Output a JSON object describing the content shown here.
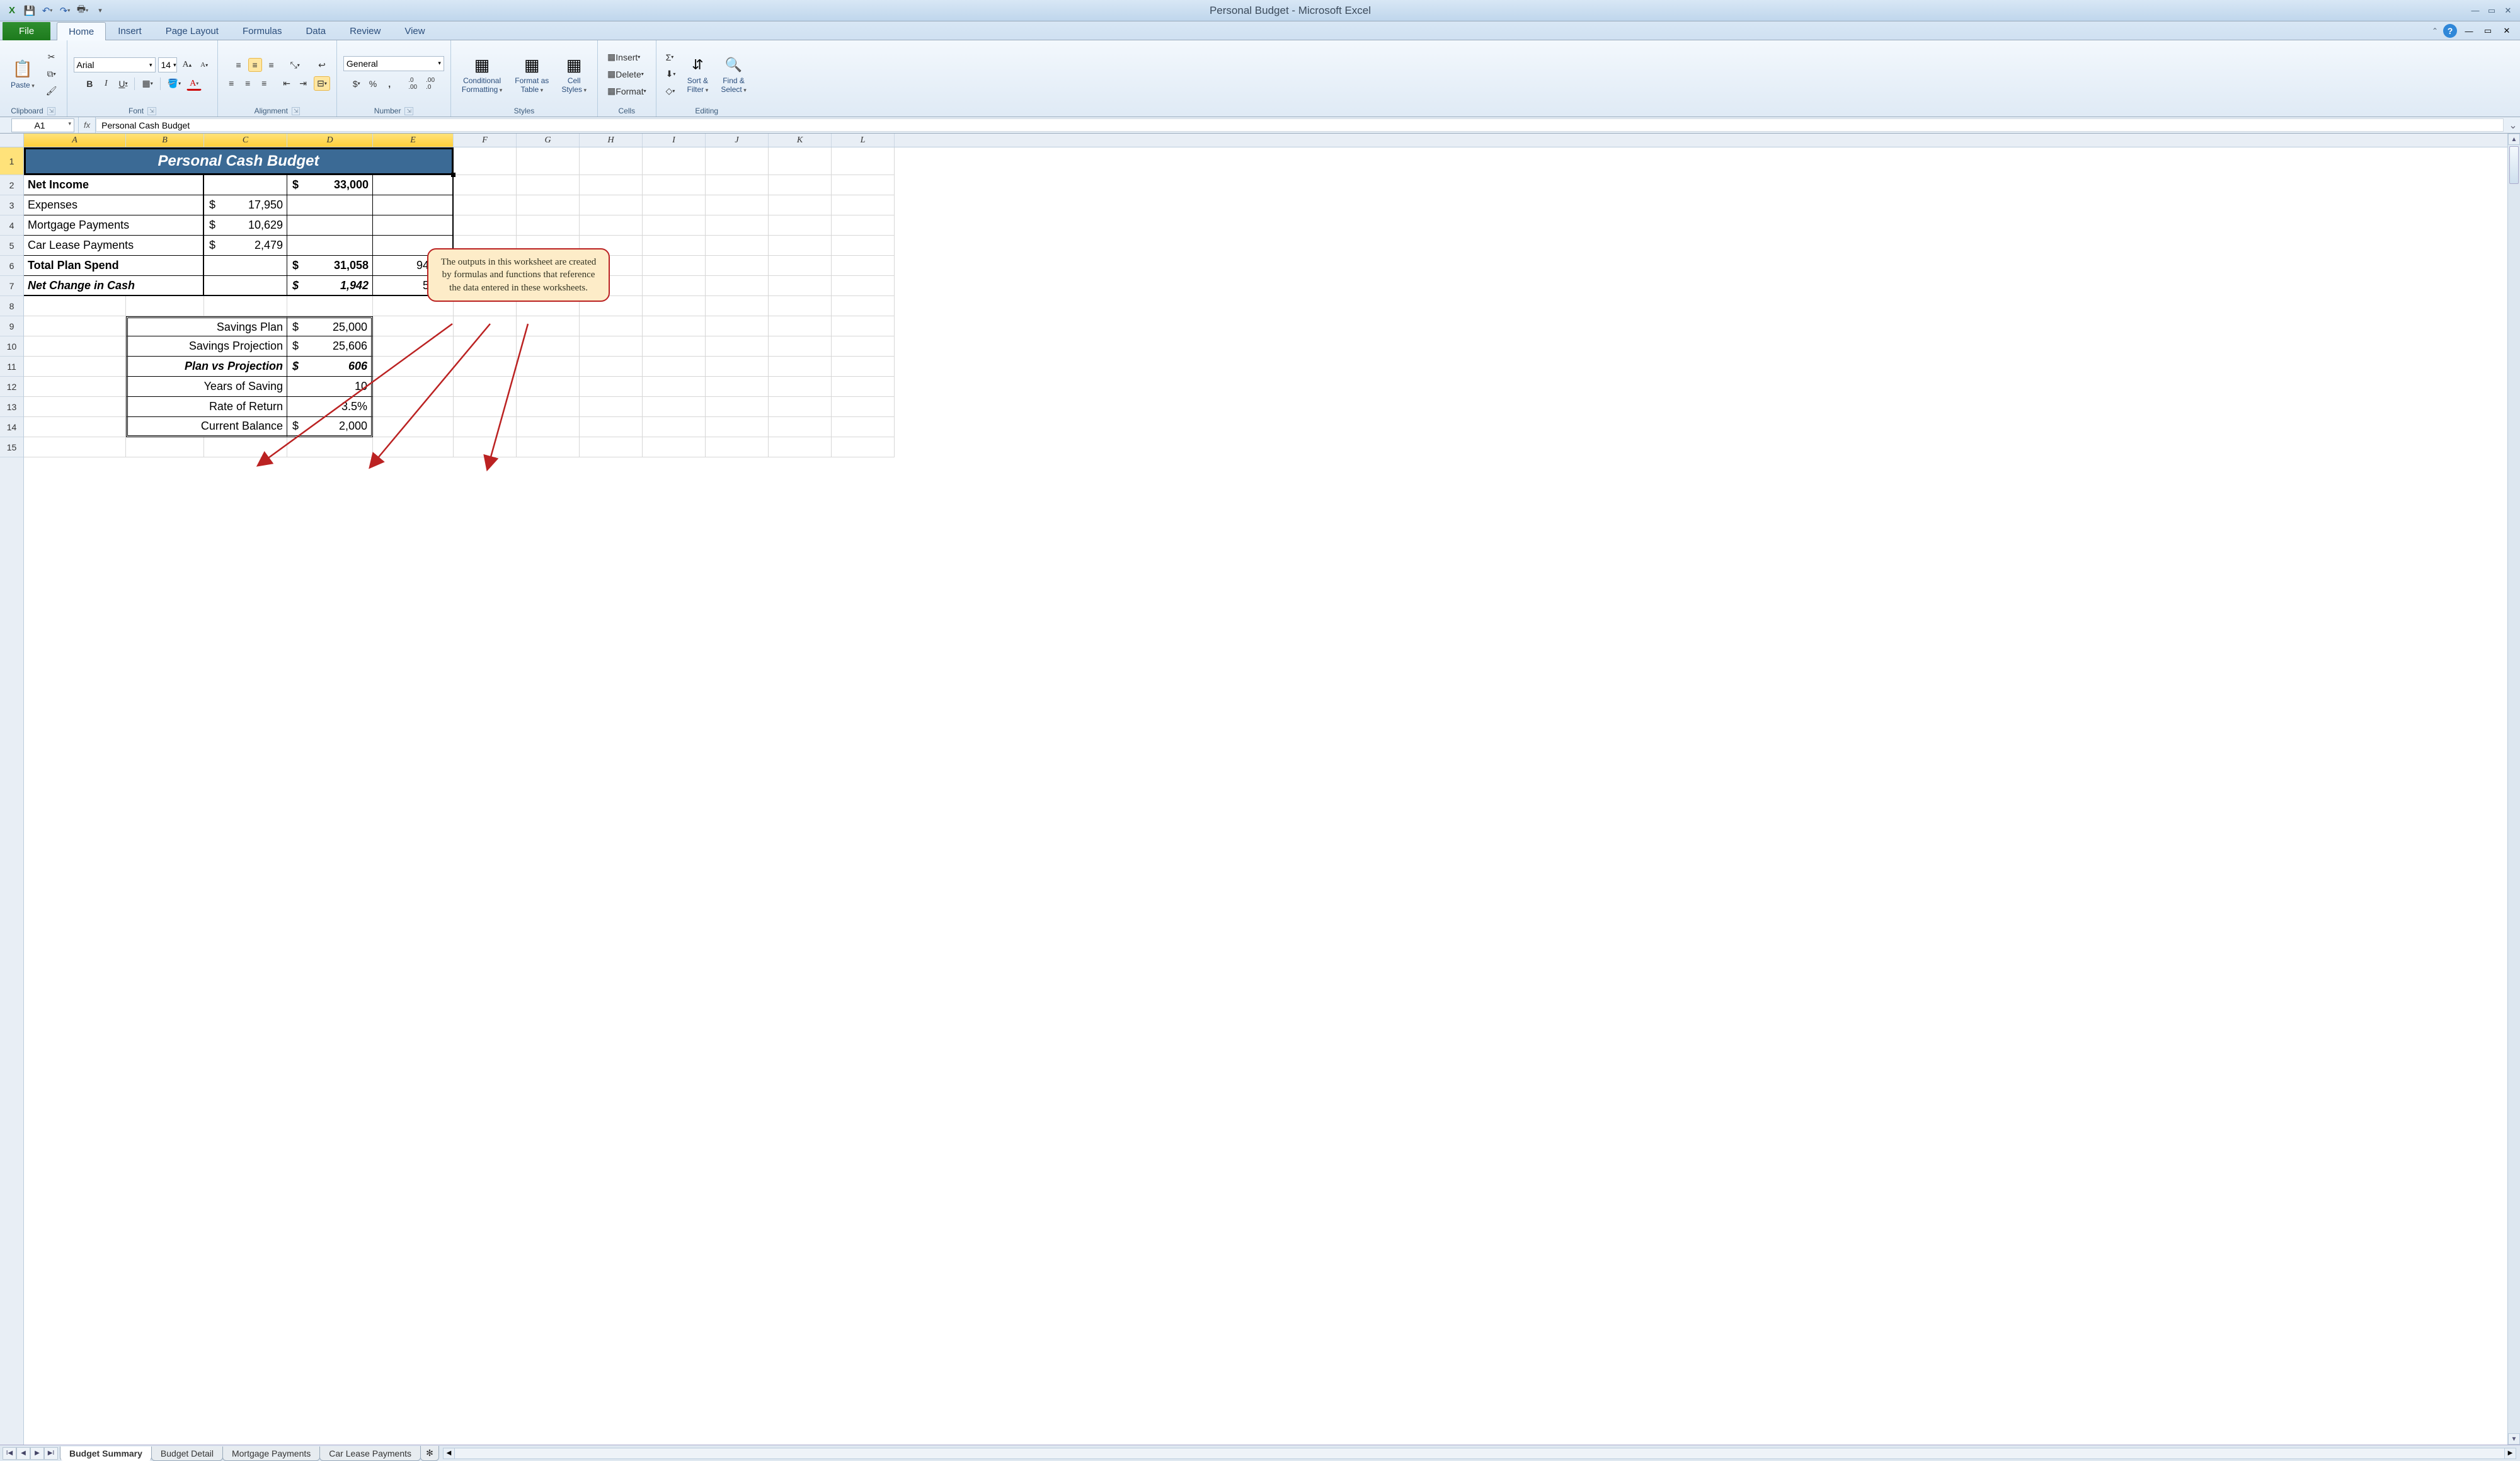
{
  "window": {
    "title": "Personal Budget - Microsoft Excel"
  },
  "ribbon": {
    "tabs": [
      "File",
      "Home",
      "Insert",
      "Page Layout",
      "Formulas",
      "Data",
      "Review",
      "View"
    ],
    "active": "Home",
    "groups": {
      "clipboard": "Clipboard",
      "font": "Font",
      "alignment": "Alignment",
      "number": "Number",
      "styles": "Styles",
      "cells": "Cells",
      "editing": "Editing"
    },
    "font": {
      "name": "Arial",
      "size": "14"
    },
    "numberFormat": "General",
    "paste": "Paste",
    "conditional": "Conditional\nFormatting",
    "formatAs": "Format as\nTable",
    "cellStyles": "Cell\nStyles",
    "insert": "Insert",
    "delete": "Delete",
    "format": "Format",
    "sortFilter": "Sort &\nFilter",
    "findSelect": "Find &\nSelect"
  },
  "namebox": "A1",
  "formula": "Personal Cash Budget",
  "columns": [
    "A",
    "B",
    "C",
    "D",
    "E",
    "F",
    "G",
    "H",
    "I",
    "J",
    "K",
    "L"
  ],
  "rows": [
    "1",
    "2",
    "3",
    "4",
    "5",
    "6",
    "7",
    "8",
    "9",
    "10",
    "11",
    "12",
    "13",
    "14",
    "15"
  ],
  "sheet": {
    "title": "Personal Cash Budget",
    "r2": {
      "label": "Net Income",
      "d": "33,000"
    },
    "r3": {
      "label": "Expenses",
      "c": "17,950"
    },
    "r4": {
      "label": "Mortgage Payments",
      "c": "10,629"
    },
    "r5": {
      "label": "Car Lease Payments",
      "c": "2,479"
    },
    "r6": {
      "label": "Total Plan Spend",
      "d": "31,058",
      "e": "94.1%"
    },
    "r7": {
      "label": "Net Change in Cash",
      "d": "1,942",
      "e": "5.9%"
    },
    "r9": {
      "label": "Savings Plan",
      "d": "25,000"
    },
    "r10": {
      "label": "Savings Projection",
      "d": "25,606"
    },
    "r11": {
      "label": "Plan vs Projection",
      "d": "606"
    },
    "r12": {
      "label": "Years of Saving",
      "d": "10"
    },
    "r13": {
      "label": "Rate of Return",
      "d": "3.5%"
    },
    "r14": {
      "label": "Current Balance",
      "d": "2,000"
    },
    "dollar": "$"
  },
  "callout": "The outputs in this worksheet are created by formulas and functions that reference the data entered in these worksheets.",
  "sheettabs": [
    "Budget Summary",
    "Budget Detail",
    "Mortgage Payments",
    "Car Lease Payments"
  ]
}
